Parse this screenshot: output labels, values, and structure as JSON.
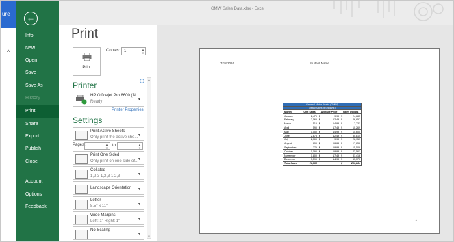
{
  "window": {
    "title": "GMW Sales Data.xlsx - Excel"
  },
  "left_tab": {
    "label": "ure"
  },
  "backstage": {
    "items": [
      "Info",
      "New",
      "Open",
      "Save",
      "Save As",
      "History",
      "Print",
      "Share",
      "Export",
      "Publish",
      "Close",
      "Account",
      "Options",
      "Feedback"
    ],
    "active": "Print",
    "disabled": [
      "History"
    ]
  },
  "print": {
    "title": "Print",
    "print_button": "Print",
    "copies_label": "Copies:",
    "copies_value": "1",
    "printer_section": "Printer",
    "printer_name": "HP Officejet Pro 8600 (N...",
    "printer_status": "Ready",
    "printer_properties": "Printer Properties",
    "settings_section": "Settings",
    "settings": [
      {
        "title": "Print Active Sheets",
        "sub": "Only print the active she..."
      },
      {
        "title": "Print One Sided",
        "sub": "Only print on one side of..."
      },
      {
        "title": "Collated",
        "sub": "1,2,3   1,2,3   1,2,3"
      },
      {
        "title": "Landscape Orientation",
        "sub": ""
      },
      {
        "title": "Letter",
        "sub": "8.5\" x 11\""
      },
      {
        "title": "Wide Margins",
        "sub": "Left: 1\"   Right: 1\""
      },
      {
        "title": "No Scaling",
        "sub": ""
      }
    ],
    "pages_label": "Pages:",
    "to_label": "to"
  },
  "preview": {
    "header_date": "7/18/2016",
    "header_name": "Student Name",
    "page_number": "1",
    "table": {
      "title1": "General Motor Works (GMW)",
      "title2": "Retail Sales (in millions)",
      "headers": [
        "Month",
        "Unit Sales",
        "Average Price",
        "Sales Dollars"
      ],
      "rows": [
        [
          "January",
          "2,470",
          "$",
          "9.99",
          "$",
          "24,685"
        ],
        [
          "February",
          "2,165",
          "$",
          "12.49",
          "$",
          "26,857"
        ],
        [
          "March",
          "515",
          "$",
          "14.99",
          "$",
          "7,731"
        ],
        [
          "April",
          "590",
          "$",
          "17.49",
          "$",
          "10,269"
        ],
        [
          "May",
          "1,050",
          "$",
          "14.99",
          "$",
          "15,605"
        ],
        [
          "June",
          "2,875",
          "$",
          "12.49",
          "$",
          "35,814"
        ],
        [
          "July",
          "2,700",
          "$",
          "9.99",
          "$",
          "26,957"
        ],
        [
          "August",
          "800",
          "$",
          "19.99",
          "$",
          "17,859"
        ],
        [
          "September",
          "775",
          "$",
          "19.99",
          "$",
          "15,508"
        ],
        [
          "October",
          "1,190",
          "$",
          "19.99",
          "$",
          "23,561"
        ],
        [
          "November",
          "1,800",
          "$",
          "17.49",
          "$",
          "31,416"
        ],
        [
          "December",
          "3,590",
          "$",
          "14.99",
          "$",
          "53,370"
        ]
      ],
      "total": [
        "Total Sales",
        "20,735",
        "",
        "",
        "$",
        "291,864"
      ]
    }
  }
}
